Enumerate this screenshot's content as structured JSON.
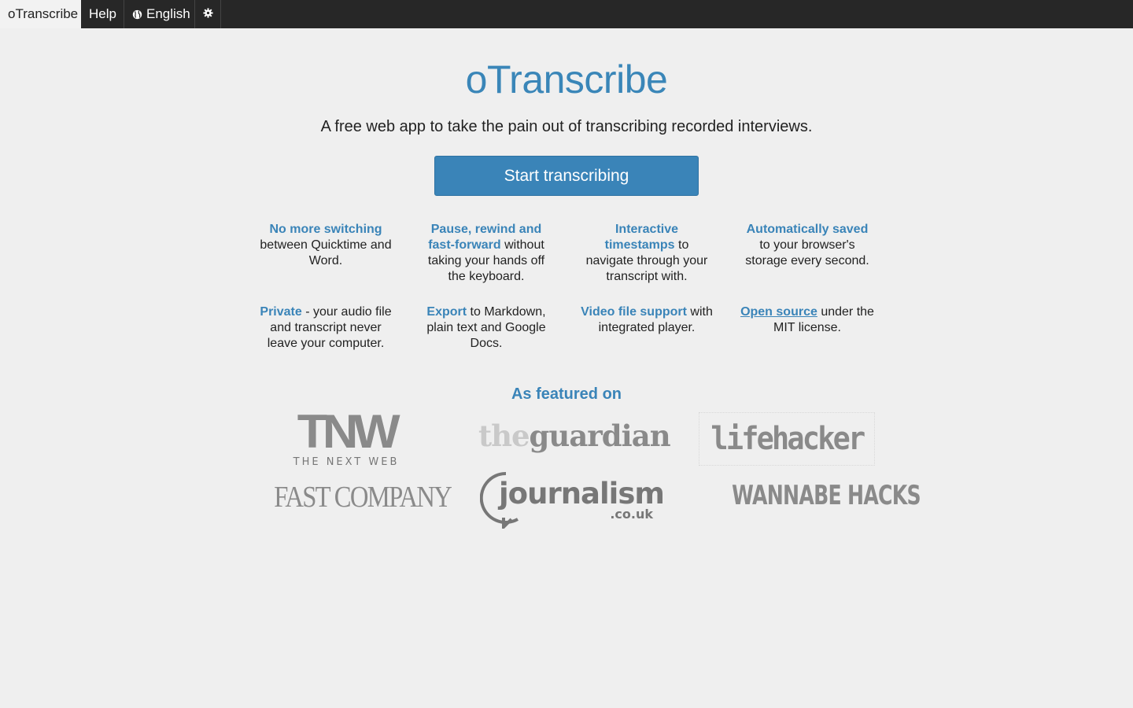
{
  "topbar": {
    "brand": "oTranscribe",
    "help": "Help",
    "language": "English",
    "globe_icon": "globe-icon",
    "settings_icon": "gear-icon"
  },
  "hero": {
    "title": "oTranscribe",
    "tagline": "A free web app to take the pain out of transcribing recorded interviews.",
    "cta": "Start transcribing"
  },
  "features": [
    {
      "highlight": "No more switching",
      "text": " between Quicktime and Word."
    },
    {
      "highlight": "Pause, rewind and fast-forward",
      "text": " without taking your hands off the keyboard."
    },
    {
      "highlight": "Interactive timestamps",
      "text": " to navigate through your transcript with."
    },
    {
      "highlight": "Automatically saved",
      "text": " to your browser's storage every second."
    },
    {
      "highlight": "Private",
      "text": " - your audio file and transcript never leave your computer."
    },
    {
      "highlight": "Export",
      "text": " to Markdown, plain text and Google Docs."
    },
    {
      "highlight": "Video file support",
      "text": " with integrated player."
    },
    {
      "highlight": "Open source",
      "text": " under the MIT license."
    }
  ],
  "featured": {
    "title": "As featured on",
    "logos": {
      "tnw_main": "TNW",
      "tnw_sub": "THE NEXT WEB",
      "guardian_the": "the",
      "guardian_word": "guardian",
      "lifehacker": "lifehacker",
      "fastcompany": "FAST COMPANY",
      "journalism": "journalism",
      "journalism_sub": ".co.uk",
      "wannabe": "WANNABE HACKS"
    }
  },
  "colors": {
    "accent": "#3a84b8",
    "topbar": "#272727",
    "background": "#efefef",
    "logo_gray": "#8a8a8a"
  }
}
